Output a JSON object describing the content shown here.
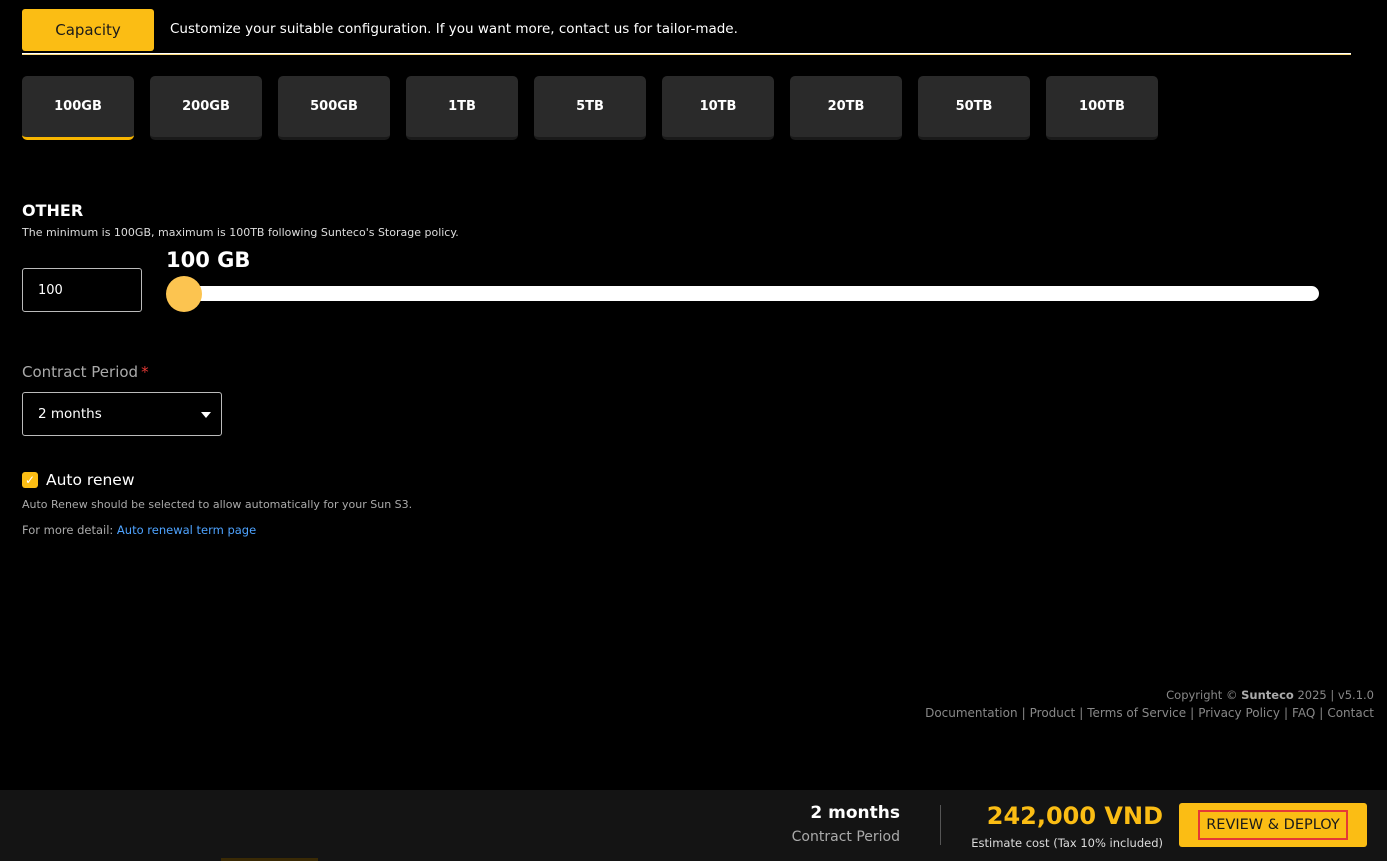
{
  "tab": {
    "label": "Capacity",
    "description": "Customize your suitable configuration. If you want more, contact us for tailor-made."
  },
  "capacity_options": [
    "100GB",
    "200GB",
    "500GB",
    "1TB",
    "5TB",
    "10TB",
    "20TB",
    "50TB",
    "100TB"
  ],
  "selected_option": "100GB",
  "other": {
    "title": "OTHER",
    "description": "The minimum is 100GB, maximum is 100TB following Sunteco's Storage policy.",
    "input_value": "100",
    "slider_value_label": "100 GB",
    "slider_min_gb": 100,
    "slider_max_gb": 102400,
    "slider_value_gb": 100
  },
  "contract_period": {
    "label": "Contract Period",
    "required_mark": "*",
    "selected": "2 months"
  },
  "auto_renew": {
    "label": "Auto renew",
    "checked": true,
    "description": "Auto Renew should be selected to allow automatically for your Sun S3.",
    "more_detail_prefix": "For more detail:",
    "link_text": "Auto renewal term page"
  },
  "footer": {
    "copyright_prefix": "Copyright ©",
    "brand": "Sunteco",
    "copyright_suffix": "2025 | v5.1.0",
    "links": [
      "Documentation",
      "Product",
      "Terms of Service",
      "Privacy Policy",
      "FAQ",
      "Contact"
    ]
  },
  "summary": {
    "period_value": "2 months",
    "period_label": "Contract Period",
    "cost": "242,000 VND",
    "cost_label": "Estimate cost (Tax 10% included)",
    "deploy_label": "REVIEW & DEPLOY"
  },
  "colors": {
    "accent": "#fbbd14",
    "background": "#000000",
    "card": "#2a2a2a",
    "link": "#4ea3ff",
    "required": "#e53935"
  }
}
